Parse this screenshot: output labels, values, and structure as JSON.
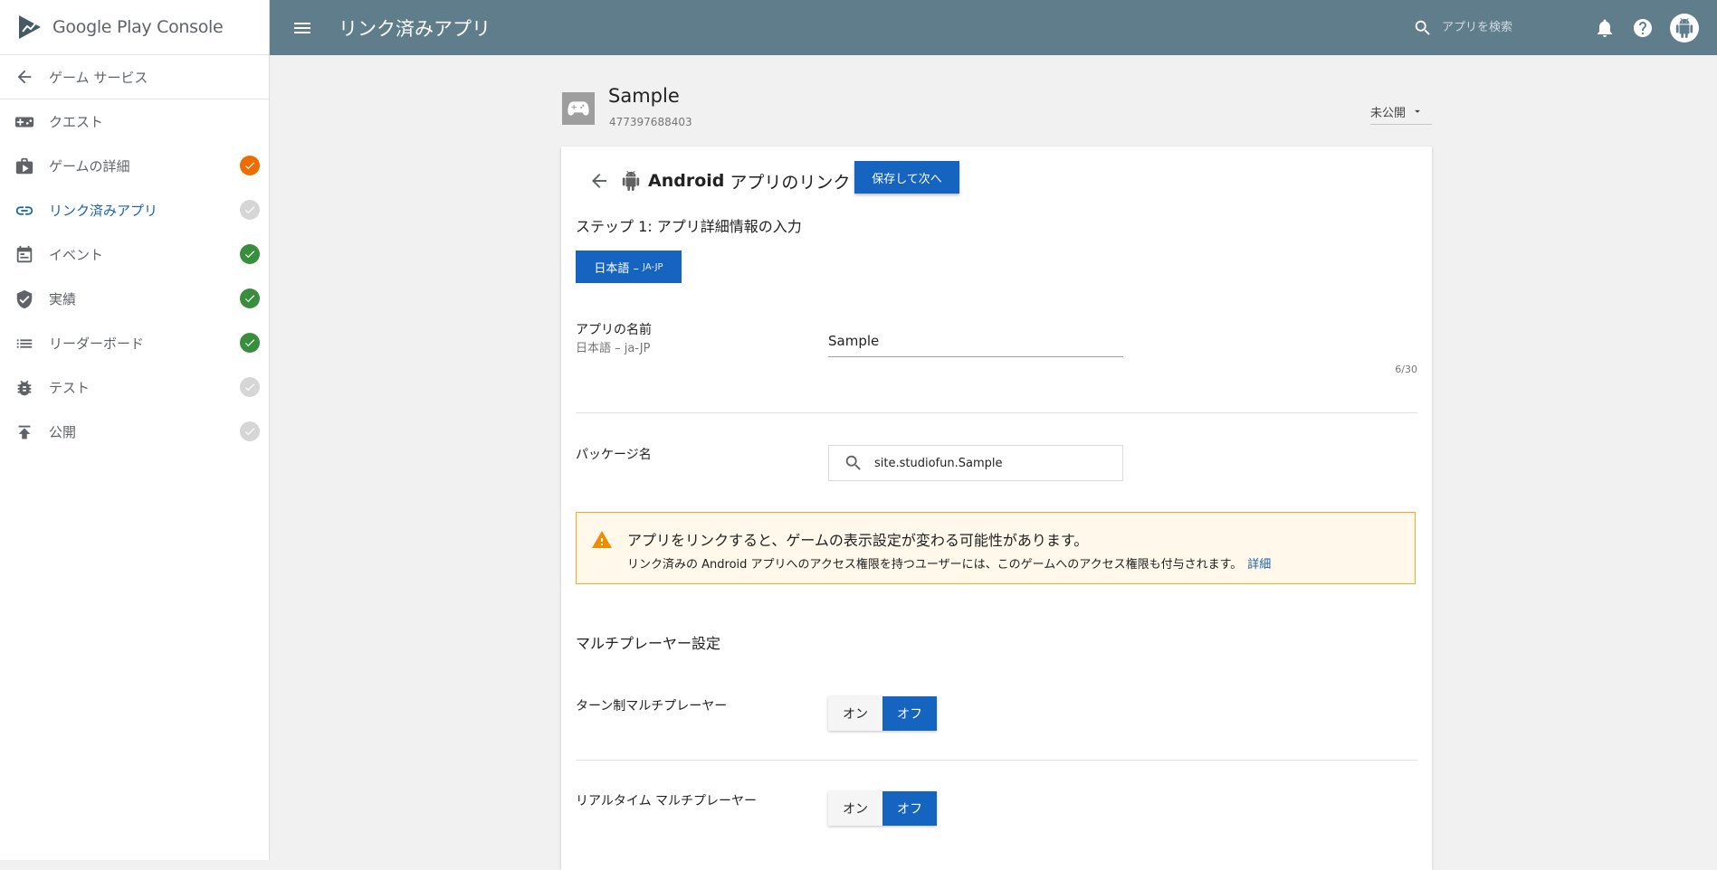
{
  "brand": {
    "name": "Google Play Console"
  },
  "sidebar": {
    "back_label": "ゲーム サービス",
    "items": [
      {
        "label": "クエスト",
        "icon": "gamepad-icon",
        "status": "none"
      },
      {
        "label": "ゲームの詳細",
        "icon": "briefcase-icon",
        "status": "warning"
      },
      {
        "label": "リンク済みアプリ",
        "icon": "link-icon",
        "status": "incomplete",
        "active": true
      },
      {
        "label": "イベント",
        "icon": "calendar-icon",
        "status": "complete"
      },
      {
        "label": "実績",
        "icon": "shield-icon",
        "status": "complete"
      },
      {
        "label": "リーダーボード",
        "icon": "list-icon",
        "status": "complete"
      },
      {
        "label": "テスト",
        "icon": "bug-icon",
        "status": "incomplete"
      },
      {
        "label": "公開",
        "icon": "publish-icon",
        "status": "incomplete"
      }
    ]
  },
  "topbar": {
    "title": "リンク済みアプリ",
    "search_placeholder": "アプリを検索"
  },
  "app": {
    "name": "Sample",
    "id": "477397688403",
    "publish_status": "未公開"
  },
  "card": {
    "title_strong": "Android",
    "title": "アプリのリンク",
    "save_next": "保存して次へ",
    "step_title": "ステップ 1: アプリ詳細情報の入力",
    "lang_main": "日本語 – ",
    "lang_sub": "JA-JP",
    "app_name_label": "アプリの名前",
    "app_name_sub": "日本語 – ja-JP",
    "app_name_value": "Sample",
    "counter": "6/30",
    "package_label": "パッケージ名",
    "package_value": "site.studiofun.Sample",
    "warning_title": "アプリをリンクすると、ゲームの表示設定が変わる可能性があります。",
    "warning_body": "リンク済みの Android アプリへのアクセス権限を持つユーザーには、このゲームへのアクセス権限も付与されます。",
    "warning_link": "詳細",
    "multiplayer_title": "マルチプレーヤー設定",
    "turn_based_label": "ターン制マルチプレーヤー",
    "realtime_label": "リアルタイム マルチプレーヤー",
    "on_label": "オン",
    "off_label": "オフ",
    "turn_based_value": "off",
    "realtime_value": "off"
  },
  "colors": {
    "topbar": "#607d8b",
    "primary": "#1565c0",
    "complete": "#388e3c",
    "warning": "#ef6c00",
    "incomplete": "#d6d6d6",
    "warning_border": "#f7a828"
  }
}
